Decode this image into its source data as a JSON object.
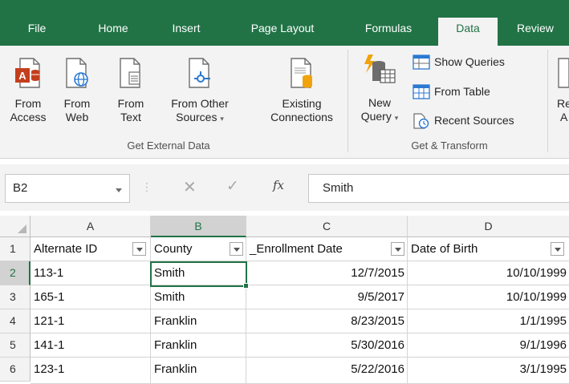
{
  "tabs": [
    {
      "label": "File",
      "active": false
    },
    {
      "label": "Home",
      "active": false
    },
    {
      "label": "Insert",
      "active": false
    },
    {
      "label": "Page Layout",
      "active": false
    },
    {
      "label": "Formulas",
      "active": false
    },
    {
      "label": "Data",
      "active": true
    },
    {
      "label": "Review",
      "active": false
    }
  ],
  "ribbon": {
    "get_external_data": {
      "group_label": "Get External Data",
      "buttons": [
        {
          "line1": "From",
          "line2": "Access",
          "icon": "access-database-icon"
        },
        {
          "line1": "From",
          "line2": "Web",
          "icon": "web-page-icon"
        },
        {
          "line1": "From",
          "line2": "Text",
          "icon": "text-file-icon"
        },
        {
          "line1": "From Other",
          "line2": "Sources",
          "icon": "other-sources-icon"
        }
      ],
      "existing": {
        "line1": "Existing",
        "line2": "Connections",
        "icon": "existing-connections-icon"
      }
    },
    "get_transform": {
      "group_label": "Get & Transform",
      "new_query": {
        "line1": "New",
        "line2": "Query",
        "icon": "new-query-icon"
      },
      "small_buttons": [
        {
          "label": "Show Queries",
          "icon": "show-queries-icon"
        },
        {
          "label": "From Table",
          "icon": "from-table-icon"
        },
        {
          "label": "Recent Sources",
          "icon": "recent-sources-icon"
        }
      ]
    },
    "cut_off": {
      "line1": "Re",
      "line2": "A"
    }
  },
  "formula_bar": {
    "name_box": "B2",
    "fx": "fx",
    "value": "Smith"
  },
  "grid": {
    "columns": [
      "A",
      "B",
      "C",
      "D"
    ],
    "selected_column": "B",
    "headers": [
      "Alternate ID",
      "County",
      "_Enrollment Date",
      "Date of Birth"
    ],
    "rows": [
      {
        "num": "1"
      },
      {
        "num": "2",
        "cells": [
          "113-1",
          "Smith",
          "12/7/2015",
          "10/10/1999"
        ]
      },
      {
        "num": "3",
        "cells": [
          "165-1",
          "Smith",
          "9/5/2017",
          "10/10/1999"
        ]
      },
      {
        "num": "4",
        "cells": [
          "121-1",
          "Franklin",
          "8/23/2015",
          "1/1/1995"
        ]
      },
      {
        "num": "5",
        "cells": [
          "141-1",
          "Franklin",
          "5/30/2016",
          "9/1/1996"
        ]
      },
      {
        "num": "6",
        "cells": [
          "123-1",
          "Franklin",
          "5/22/2016",
          "3/1/1995"
        ]
      }
    ],
    "selected_row": "2"
  },
  "colors": {
    "accent": "#217346",
    "ribbon_bg": "#f3f3f3",
    "access_red": "#c43e1c",
    "query_orange": "#f0a30a",
    "web_blue": "#2b79d0"
  }
}
